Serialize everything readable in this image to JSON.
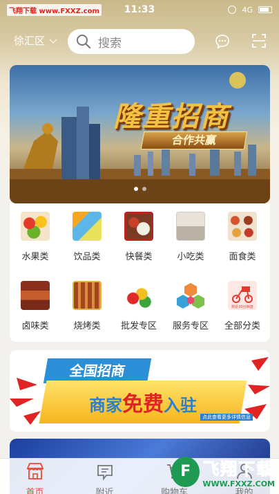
{
  "status_bar": {
    "watermark": "飞翔下载 www.FXXZ.com",
    "time": "11:33",
    "network": "4G"
  },
  "header": {
    "district": "徐汇区",
    "search_placeholder": "搜索",
    "icons": [
      "message-icon",
      "scan-icon"
    ]
  },
  "banner": {
    "title": "隆重招商",
    "subtitle": "合作共赢",
    "dots": 2,
    "active_dot": 0
  },
  "categories": [
    {
      "label": "水果类",
      "icon": "fruit-icon"
    },
    {
      "label": "饮品类",
      "icon": "drink-icon"
    },
    {
      "label": "快餐类",
      "icon": "fastfood-icon"
    },
    {
      "label": "小吃类",
      "icon": "snack-icon"
    },
    {
      "label": "面食类",
      "icon": "noodle-icon"
    },
    {
      "label": "卤味类",
      "icon": "braised-icon"
    },
    {
      "label": "烧烤类",
      "icon": "bbq-icon"
    },
    {
      "label": "批发专区",
      "icon": "wholesale-icon"
    },
    {
      "label": "服务专区",
      "icon": "service-icon"
    },
    {
      "label": "全部分类",
      "icon": "delivery-icon"
    }
  ],
  "delivery_icon_caption": "附近30分钟送",
  "promo": {
    "line1": "全国招商",
    "line2_a": "商家",
    "line2_hl": "免费",
    "line2_b": "入驻",
    "small": "点此查看更多详情信息"
  },
  "tabs": [
    {
      "label": "首页",
      "icon": "store-icon",
      "active": true
    },
    {
      "label": "附近",
      "icon": "nearby-icon",
      "active": false
    },
    {
      "label": "购物车",
      "icon": "cart-icon",
      "active": false
    },
    {
      "label": "我的",
      "icon": "user-icon",
      "active": false
    }
  ],
  "site_watermark": {
    "logo": "F",
    "name": "飞翔下载",
    "url": "WWW.FXXZ.COM"
  },
  "colors": {
    "accent": "#e64a3b",
    "header_gold": "#c9b98a",
    "promo_blue": "#2b7fcf",
    "promo_yellow": "#f6b51e"
  }
}
